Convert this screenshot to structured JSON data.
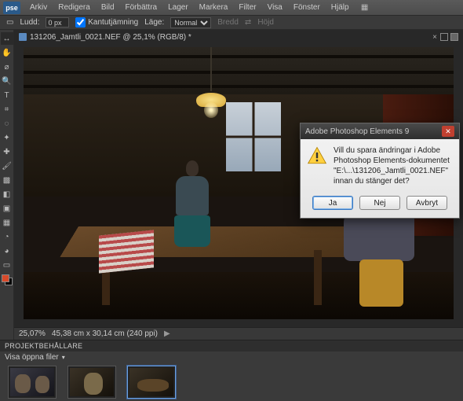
{
  "app": {
    "logo": "pse"
  },
  "menu": [
    "Arkiv",
    "Redigera",
    "Bild",
    "Förbättra",
    "Lager",
    "Markera",
    "Filter",
    "Visa",
    "Fönster",
    "Hjälp"
  ],
  "options_bar": {
    "ludd_label": "Ludd:",
    "ludd_value": "0 px",
    "kantut_label": "Kantutjämning",
    "lager_label": "Läge:",
    "lager_value": "Normal",
    "brodd_label": "Bredd",
    "hojd_label": "Höjd"
  },
  "document": {
    "title": "131206_Jamtli_0021.NEF @ 25,1% (RGB/8) *"
  },
  "statusbar": {
    "zoom": "25,07%",
    "dims": "45,38 cm x 30,14 cm (240 ppi)"
  },
  "dialog": {
    "title": "Adobe Photoshop Elements 9",
    "message": "Vill du spara ändringar i Adobe Photoshop Elements-dokumentet \"E:\\...\\131206_Jamtli_0021.NEF\" innan du stänger det?",
    "btn_yes": "Ja",
    "btn_no": "Nej",
    "btn_cancel": "Avbryt"
  },
  "bin": {
    "title": "PROJEKTBEHÅLLARE",
    "filter": "Visa öppna filer"
  },
  "tools": {
    "move": "↔",
    "hand": "✋",
    "eyedrop": "⌀",
    "zoom": "🔍",
    "type": "T",
    "crop": "⌗",
    "lasso": "◌",
    "wand": "✦",
    "heal": "✚",
    "brush": "🖌",
    "stamp": "▩",
    "eraser": "◧",
    "fill": "▣",
    "grad": "▦",
    "blur": "◔",
    "sponge": "◕",
    "shape": "▭"
  }
}
